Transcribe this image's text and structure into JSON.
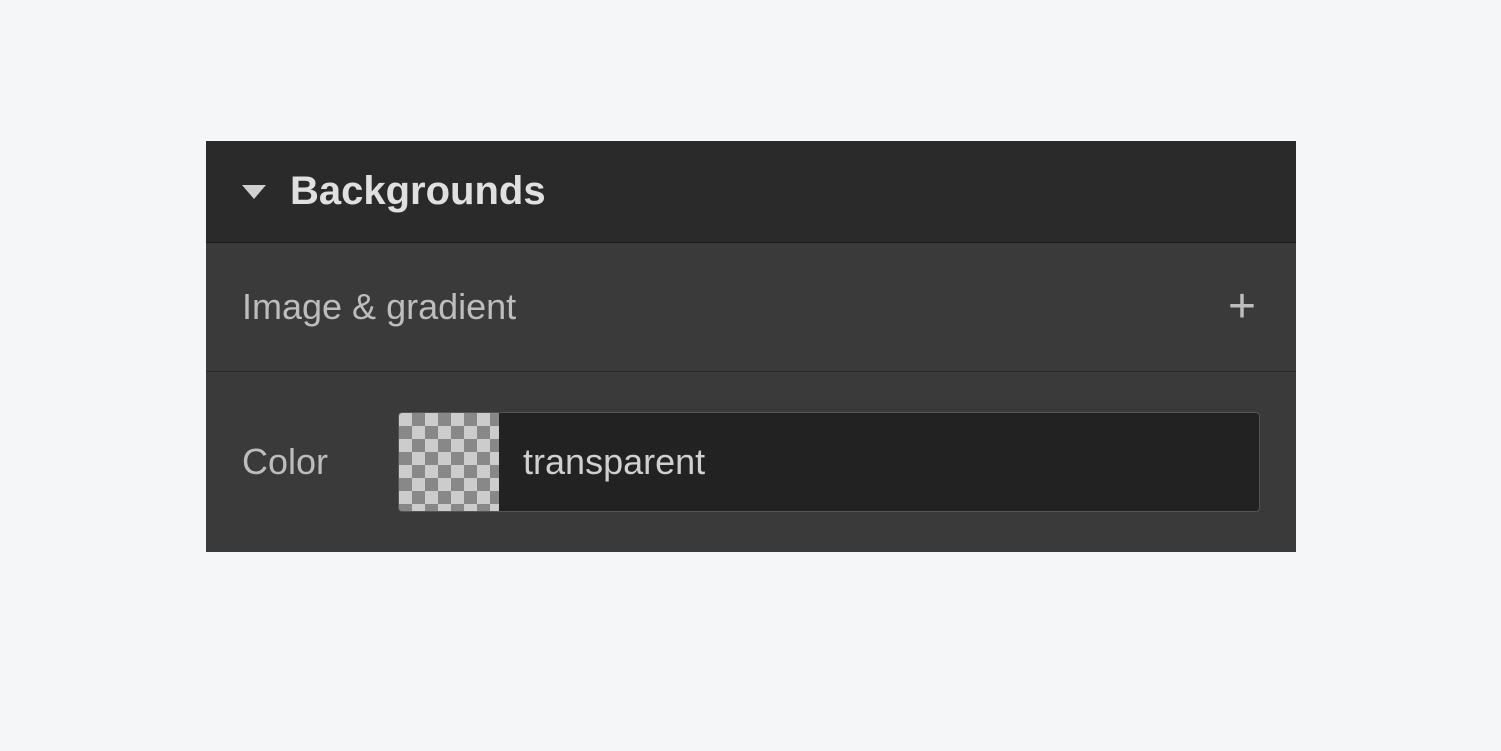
{
  "panel": {
    "section_title": "Backgrounds",
    "image_gradient_label": "Image & gradient",
    "color_label": "Color",
    "color_value": "transparent"
  }
}
